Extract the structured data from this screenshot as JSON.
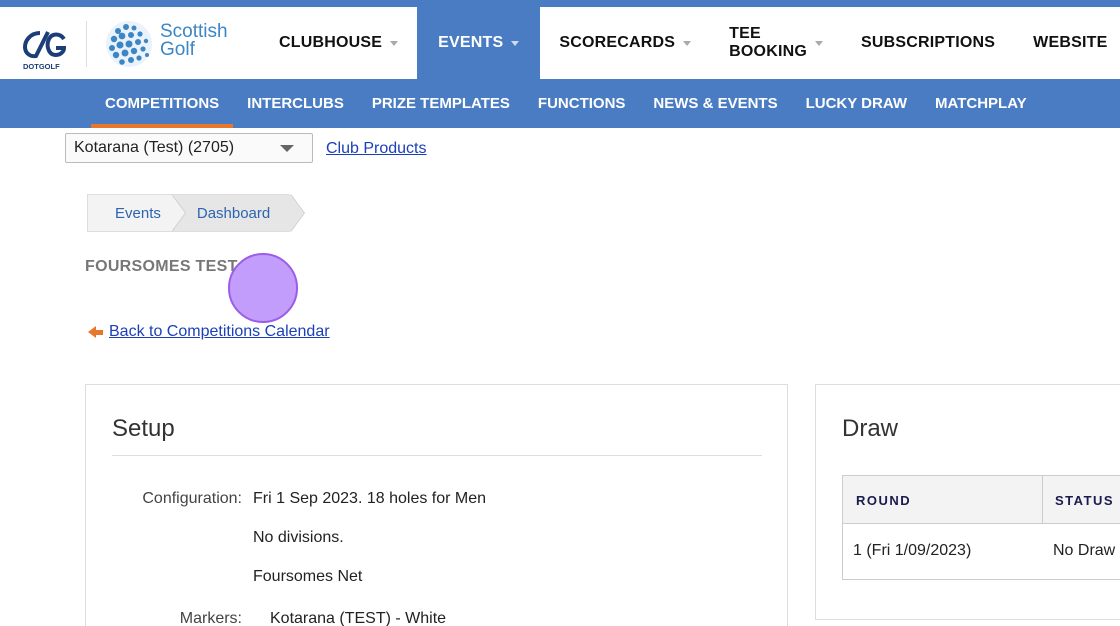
{
  "brand": {
    "dotgolf_label": "DOTGOLF",
    "scottish_golf_line1": "Scottish",
    "scottish_golf_line2": "Golf"
  },
  "main_nav": [
    {
      "label": "CLUBHOUSE",
      "dropdown": true
    },
    {
      "label": "EVENTS",
      "dropdown": true,
      "active": true
    },
    {
      "label": "SCORECARDS",
      "dropdown": true
    },
    {
      "label": "TEE BOOKING",
      "dropdown": true
    },
    {
      "label": "SUBSCRIPTIONS",
      "dropdown": false
    },
    {
      "label": "WEBSITE",
      "dropdown": false
    }
  ],
  "sub_nav": [
    {
      "label": "COMPETITIONS",
      "active": true
    },
    {
      "label": "INTERCLUBS"
    },
    {
      "label": "PRIZE TEMPLATES"
    },
    {
      "label": "FUNCTIONS"
    },
    {
      "label": "NEWS & EVENTS"
    },
    {
      "label": "LUCKY DRAW"
    },
    {
      "label": "MATCHPLAY"
    }
  ],
  "club_selector": {
    "value": "Kotarana (Test) (2705)"
  },
  "club_products_link": "Club Products",
  "breadcrumb": [
    "Events",
    "Dashboard"
  ],
  "competition_title": "FOURSOMES TEST",
  "back_link": "Back to Competitions Calendar",
  "setup": {
    "heading": "Setup",
    "configuration_label": "Configuration:",
    "configuration_lines": [
      "Fri 1 Sep 2023. 18 holes for Men",
      "No divisions.",
      "Foursomes Net"
    ],
    "markers_label": "Markers:",
    "markers_value": "Kotarana (TEST) - White"
  },
  "draw": {
    "heading": "Draw",
    "columns": [
      "ROUND",
      "STATUS"
    ],
    "rows": [
      {
        "round": "1 (Fri 1/09/2023)",
        "status": "No Draw"
      }
    ]
  },
  "colors": {
    "brand_blue": "#4a7cc4",
    "accent_orange": "#e8772e",
    "link_blue": "#1a3fb8"
  }
}
